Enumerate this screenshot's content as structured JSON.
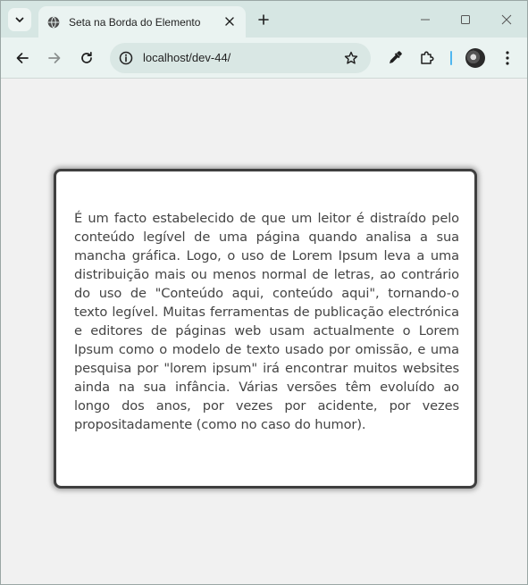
{
  "browser": {
    "tab_title": "Seta na Borda do Elemento",
    "url": "localhost/dev-44/",
    "icons": {
      "tab_search": "chevron-down-icon",
      "favicon": "globe-icon",
      "close": "close-icon",
      "new_tab": "plus-icon",
      "minimize": "minimize-icon",
      "maximize": "maximize-icon",
      "window_close": "close-icon",
      "back": "arrow-left-icon",
      "forward": "arrow-right-icon",
      "reload": "reload-icon",
      "site_info": "site-info-icon",
      "bookmark": "star-icon",
      "eyedropper": "eyedropper-icon",
      "extensions": "puzzle-icon",
      "profile": "avatar",
      "menu": "kebab-menu-icon"
    }
  },
  "page": {
    "paragraph": "É um facto estabelecido de que um leitor é distraído pelo conteúdo legível de uma página quando analisa a sua mancha gráfica. Logo, o uso de Lorem Ipsum leva a uma distribuição mais ou menos normal de letras, ao contrário do uso de \"Conteúdo aqui, conteúdo aqui\", tornando-o texto legível. Muitas ferramentas de publicação electrónica e editores de páginas web usam actualmente o Lorem Ipsum como o modelo de texto usado por omissão, e uma pesquisa por \"lorem ipsum\" irá encontrar muitos websites ainda na sua infância. Várias versões têm evoluído ao longo dos anos, por vezes por acidente, por vezes propositadamente (como no caso do humor)."
  },
  "colors": {
    "tabstrip": "#d6e6e3",
    "toolbar": "#eaf3f1",
    "page_bg": "#f1f1f1",
    "card_border": "#3f3f3f",
    "text": "#444444"
  }
}
